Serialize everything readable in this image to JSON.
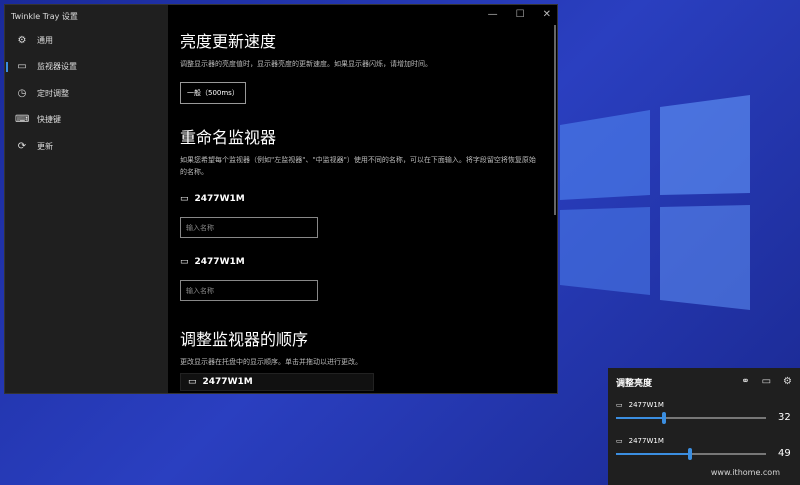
{
  "window": {
    "title": "Twinkle Tray 设置",
    "controls": [
      "—",
      "☐",
      "✕"
    ]
  },
  "sidebar": {
    "items": [
      {
        "label": "通用",
        "icon": "gear-icon",
        "glyph": "⚙"
      },
      {
        "label": "监视器设置",
        "icon": "monitor-icon",
        "glyph": "▭"
      },
      {
        "label": "定时调整",
        "icon": "clock-icon",
        "glyph": "◷"
      },
      {
        "label": "快捷键",
        "icon": "keyboard-icon",
        "glyph": "⌨"
      },
      {
        "label": "更新",
        "icon": "refresh-icon",
        "glyph": "⟳"
      }
    ],
    "active": 1
  },
  "speed": {
    "title": "亮度更新速度",
    "desc": "调整显示器的亮度值时，显示器亮度的更新速度。如果显示器闪烁，请增加时间。",
    "button": "一般（500ms）"
  },
  "rename": {
    "title": "重命名监视器",
    "desc": "如果您希望每个监视器（例如\"左监视器\"、\"中监视器\"）使用不同的名称，可以在下面输入。将字段留空将恢复原始的名称。",
    "monitors": [
      {
        "name": "2477W1M",
        "placeholder": "输入名称"
      },
      {
        "name": "2477W1M",
        "placeholder": "输入名称"
      }
    ]
  },
  "order": {
    "title": "调整监视器的顺序",
    "desc": "更改显示器在托盘中的显示顺序。单击并拖动以进行更改。",
    "items": [
      "2477W1M"
    ]
  },
  "flyout": {
    "title": "调整亮度",
    "monitors": [
      {
        "name": "2477W1M",
        "value": "32",
        "level": 32
      },
      {
        "name": "2477W1M",
        "value": "49",
        "level": 49
      }
    ]
  },
  "watermark": {
    "text": "www.ithome.com"
  },
  "colors": {
    "accent": "#3b8ee0"
  }
}
